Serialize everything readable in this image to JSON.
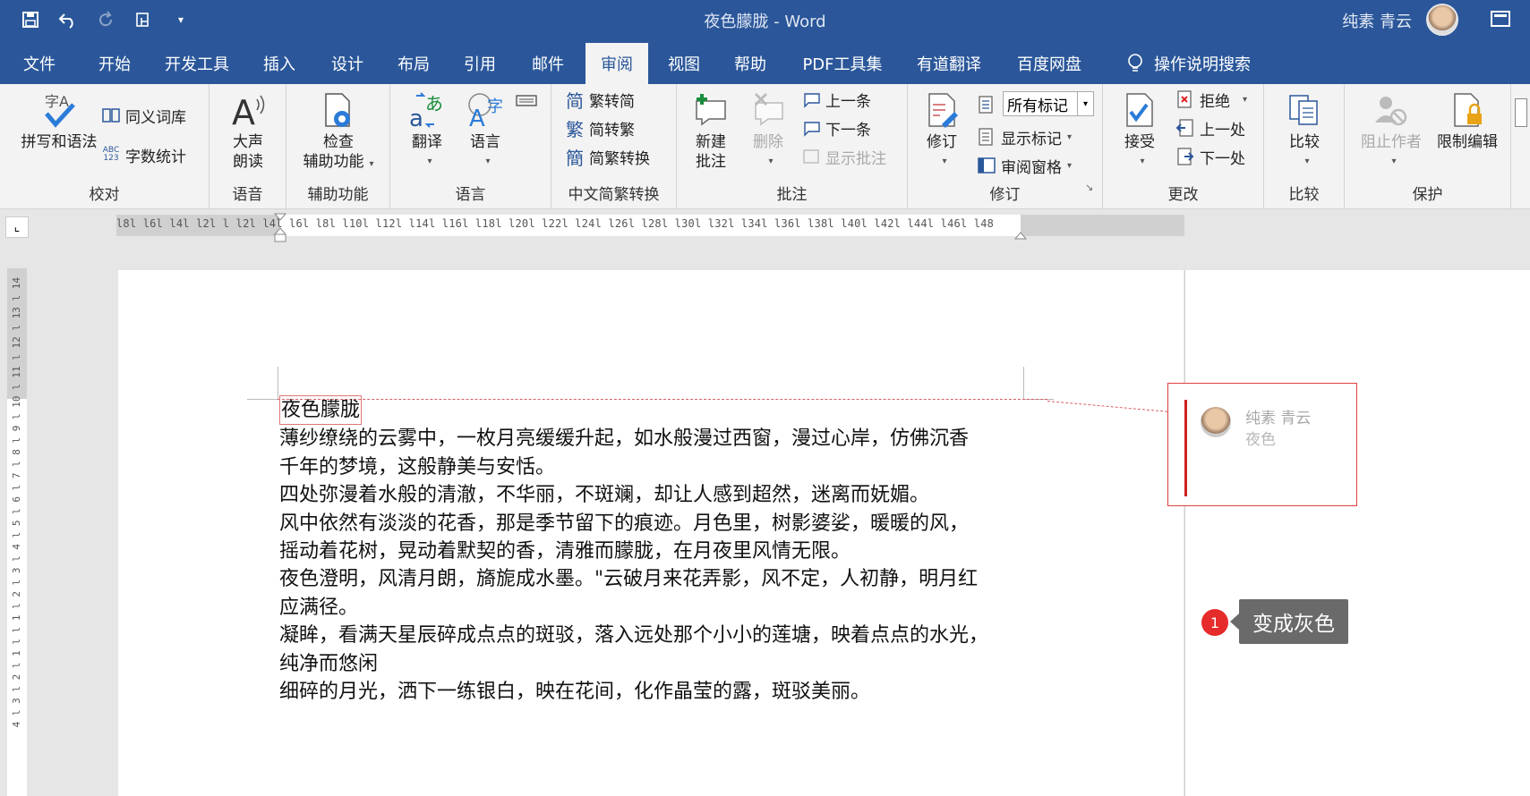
{
  "window": {
    "title": "夜色朦胧 - Word",
    "user": "纯素 青云"
  },
  "tabs": [
    "文件",
    "开始",
    "开发工具",
    "插入",
    "设计",
    "布局",
    "引用",
    "邮件",
    "审阅",
    "视图",
    "帮助",
    "PDF工具集",
    "有道翻译",
    "百度网盘",
    "操作说明搜索"
  ],
  "active_tab": "审阅",
  "ribbon": {
    "proofing": {
      "label": "校对",
      "spell": "拼写和语法",
      "thesaurus": "同义词库",
      "wordcount": "字数统计"
    },
    "speech": {
      "label": "语音",
      "read_aloud_1": "大声",
      "read_aloud_2": "朗读"
    },
    "accessibility": {
      "label": "辅助功能",
      "check_1": "检查",
      "check_2": "辅助功能"
    },
    "language": {
      "label": "语言",
      "translate": "翻译",
      "language": "语言"
    },
    "chinese": {
      "label": "中文简繁转换",
      "to_trad": "繁转简",
      "to_simp": "简转繁",
      "convert": "简繁转换"
    },
    "comments": {
      "label": "批注",
      "new_1": "新建",
      "new_2": "批注",
      "delete": "删除",
      "prev": "上一条",
      "next": "下一条",
      "show": "显示批注"
    },
    "tracking": {
      "label": "修订",
      "track": "修订",
      "all_markup": "所有标记",
      "show_markup": "显示标记",
      "review_pane": "审阅窗格"
    },
    "changes": {
      "label": "更改",
      "accept": "接受",
      "reject": "拒绝",
      "prev": "上一处",
      "next": "下一处"
    },
    "compare": {
      "label": "比较",
      "compare": "比较"
    },
    "protect": {
      "label": "保护",
      "block": "阻止作者",
      "restrict": "限制编辑"
    }
  },
  "ruler": {
    "h_numbers": "l8l  l6l  l4l  l2l  l   l2l  l4l  l6l  l8l  l10l l12l l14l l16l l18l l20l l22l l24l l26l l28l l30l l32l l34l l36l l38l l40l l42l l44l l46l l48",
    "v_numbers": "4 l 3 l 2 l 1 l   l 1 l 2 l 3 l 4 l 5 l 6 l 7 l 8 l 9 l 10 l 11 l 12 l 13 l 14"
  },
  "document": {
    "title": "夜色朦胧",
    "lines": [
      "薄纱缭绕的云雾中，一枚月亮缓缓升起，如水般漫过西窗，漫过心岸，仿佛沉香",
      "千年的梦境，这般静美与安恬。",
      "四处弥漫着水般的清澈，不华丽，不斑斓，却让人感到超然，迷离而妩媚。",
      "风中依然有淡淡的花香，那是季节留下的痕迹。月色里，树影婆娑，暖暖的风，",
      "摇动着花树，晃动着默契的香，清雅而朦胧，在月夜里风情无限。",
      "夜色澄明，风清月朗，旖旎成水墨。\"云破月来花弄影，风不定，人初静，明月红",
      "应满径。",
      "凝眸，看满天星辰碎成点点的斑驳，落入远处那个小小的莲塘，映着点点的水光，",
      "纯净而悠闲",
      "细碎的月光，洒下一练银白，映在花间，化作晶莹的露，斑驳美丽。"
    ]
  },
  "comment": {
    "author": "纯素  青云",
    "text": "夜色"
  },
  "annotation": {
    "number": "1",
    "text": "变成灰色"
  },
  "colors": {
    "word_blue": "#2b579a",
    "markup_red": "#d02020"
  }
}
